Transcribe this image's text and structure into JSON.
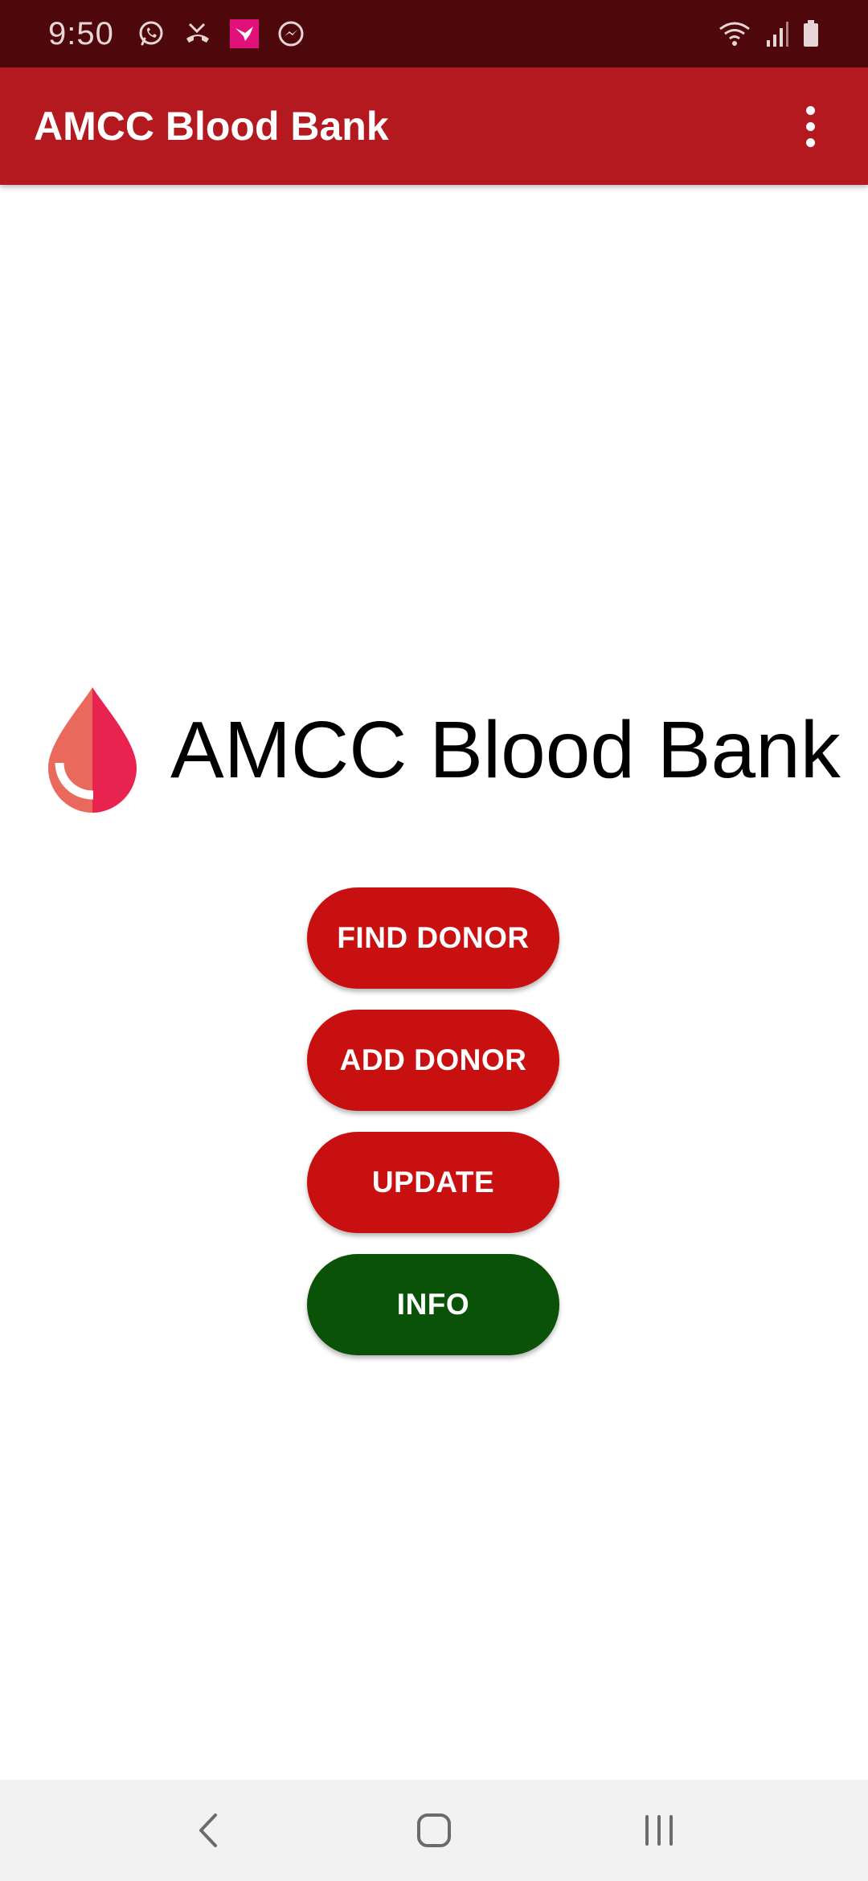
{
  "status_bar": {
    "time": "9:50",
    "left_icons": [
      "whatsapp-icon",
      "missed-call-icon",
      "bird-app-icon",
      "messenger-icon"
    ],
    "right_icons": [
      "wifi-icon",
      "signal-icon",
      "battery-icon"
    ]
  },
  "app_bar": {
    "title": "AMCC Blood Bank",
    "overflow_icon": "more-vert-icon"
  },
  "logo": {
    "icon": "blood-drop-icon",
    "text": "AMCC Blood Bank"
  },
  "buttons": [
    {
      "label": "FIND DONOR",
      "color": "#c81010"
    },
    {
      "label": "ADD DONOR",
      "color": "#c81010"
    },
    {
      "label": "UPDATE",
      "color": "#c81010"
    },
    {
      "label": "INFO",
      "color": "#0a5208"
    }
  ],
  "nav_bar": {
    "icons": [
      "back-icon",
      "home-icon",
      "recents-icon"
    ]
  },
  "colors": {
    "status_bar": "#4e070b",
    "app_bar": "#b3191e",
    "accent_red": "#c81010",
    "accent_green": "#0a5208"
  }
}
